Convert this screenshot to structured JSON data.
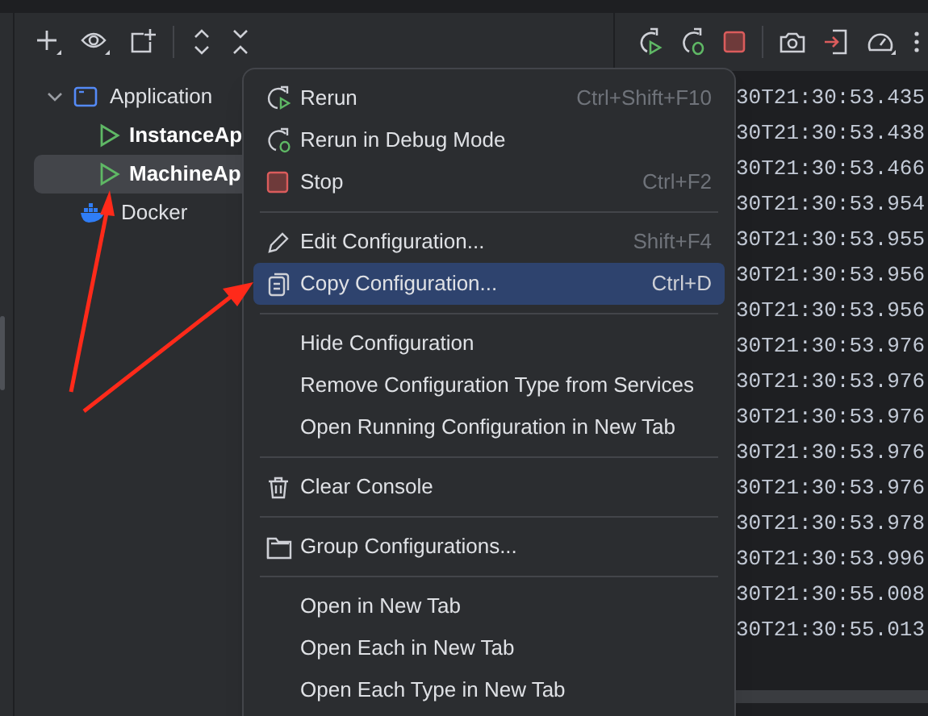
{
  "services_tree": [
    {
      "label": "Application",
      "expanded": true,
      "children": [
        {
          "label": "InstanceAp",
          "selected": false
        },
        {
          "label": "MachineAp",
          "selected": true
        }
      ]
    },
    {
      "label": "Docker",
      "selected": false
    }
  ],
  "context_menu": {
    "groups": [
      [
        {
          "label": "Rerun",
          "shortcut": "Ctrl+Shift+F10",
          "selected": false
        },
        {
          "label": "Rerun in Debug Mode",
          "selected": false
        },
        {
          "label": "Stop",
          "shortcut": "Ctrl+F2",
          "selected": false
        }
      ],
      [
        {
          "label": "Edit Configuration...",
          "shortcut": "Shift+F4",
          "selected": false
        },
        {
          "label": "Copy Configuration...",
          "shortcut": "Ctrl+D",
          "selected": true
        }
      ],
      [
        {
          "label": "Hide Configuration",
          "selected": false
        },
        {
          "label": "Remove Configuration Type from Services",
          "selected": false
        },
        {
          "label": "Open Running Configuration in New Tab",
          "selected": false
        }
      ],
      [
        {
          "label": "Clear Console",
          "selected": false
        }
      ],
      [
        {
          "label": "Group Configurations...",
          "selected": false
        }
      ],
      [
        {
          "label": "Open in New Tab",
          "selected": false
        },
        {
          "label": "Open Each in New Tab",
          "selected": false
        },
        {
          "label": "Open Each Type in New Tab",
          "selected": false
        }
      ]
    ]
  },
  "console_lines": [
    "30T21:30:53.435",
    "30T21:30:53.438",
    "30T21:30:53.466",
    "30T21:30:53.954",
    "30T21:30:53.955",
    "30T21:30:53.956",
    "30T21:30:53.956",
    "30T21:30:53.976",
    "30T21:30:53.976",
    "30T21:30:53.976",
    "30T21:30:53.976",
    "30T21:30:53.976",
    "30T21:30:53.978",
    "30T21:30:53.996",
    "30T21:30:55.008",
    "30T21:30:55.013"
  ]
}
